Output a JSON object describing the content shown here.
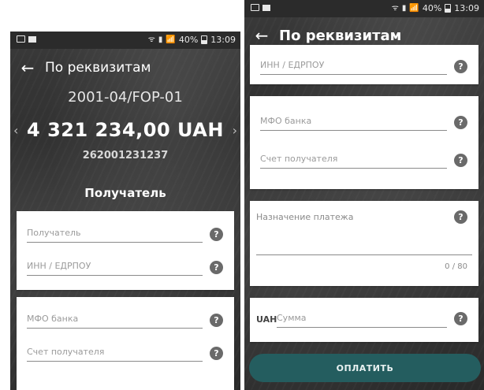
{
  "status_bar": {
    "time": "13:09",
    "battery": "40%",
    "signal_glyph": "📶",
    "wifi_glyph": "ᯤ",
    "icons": [
      "image-icon",
      "notification-box-icon",
      "wifi-icon",
      "sim-icon",
      "signal-icon",
      "battery-icon"
    ]
  },
  "left": {
    "back_icon": "←",
    "title": "По реквизитам",
    "account_code": "2001-04/FOP-01",
    "amount": "4 321 234,00 UAH",
    "prev_chevron": "‹",
    "next_chevron": "›",
    "account_number": "262001231237",
    "section_heading": "Получатель",
    "fields": [
      {
        "placeholder": "Получатель"
      },
      {
        "placeholder": "ИНН / ЕДРПОУ"
      },
      {
        "placeholder": "МФО банка"
      },
      {
        "placeholder": "Счет получателя"
      }
    ],
    "help_glyph": "?"
  },
  "right": {
    "back_icon": "←",
    "title": "По реквизитам",
    "fields": [
      {
        "placeholder": "ИНН / ЕДРПОУ"
      },
      {
        "placeholder": "МФО банка"
      },
      {
        "placeholder": "Счет получателя"
      }
    ],
    "purpose": {
      "label": "Назначение платежа",
      "counter": "0 / 80"
    },
    "amount": {
      "currency": "UAH",
      "placeholder": "Сумма"
    },
    "pay_button": "ОПЛАТИТЬ",
    "help_glyph": "?"
  },
  "colors": {
    "background": "#333333",
    "card": "#ffffff",
    "pay_button": "#245d5f",
    "help_icon": "#6a6a6a"
  }
}
